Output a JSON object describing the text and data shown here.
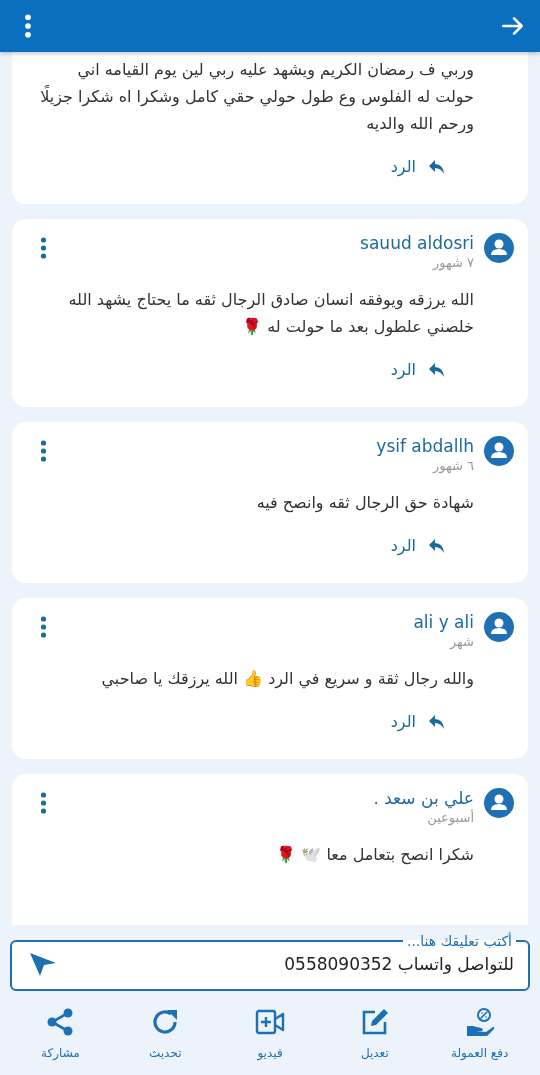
{
  "comments": [
    {
      "text": "وربي ف رمضان الكريم ويشهد عليه ربي لين يوم القيامه اني حولت له الفلوس وع طول حولي حقي كامل وشكرا اه شكرا جزيلًا ورحم الله والديه",
      "reply_label": "الرد"
    },
    {
      "author": "sauud aldosri",
      "time": "٧ شهور",
      "text": "الله يرزقه ويوفقه انسان صادق الرجال ثقه ما يحتاج  يشهد الله خلصني علطول بعد ما حولت له 🌹",
      "reply_label": "الرد"
    },
    {
      "author": "ysif abdallh",
      "time": "٦ شهور",
      "text": "شهادة حق الرجال ثقه وانصح فيه",
      "reply_label": "الرد"
    },
    {
      "author": "ali y ali",
      "time": "شهر",
      "text": "والله رجال ثقة و سريع في الرد 👍 الله يرزقك يا صاحبي",
      "reply_label": "الرد"
    },
    {
      "author": "علي بن سعد .",
      "time": "أسبوعين",
      "text": "شكرا انصح بتعامل معا 🕊️ 🌹"
    }
  ],
  "composer": {
    "label": "أكتب تعليقك هنا...",
    "value": "للتواصل واتساب 0558090352"
  },
  "bottom_nav": [
    {
      "kind": "commission",
      "label": "دفع العمولة"
    },
    {
      "kind": "edit",
      "label": "تعديل"
    },
    {
      "kind": "video",
      "label": "فيديو"
    },
    {
      "kind": "refresh",
      "label": "تحديث"
    },
    {
      "kind": "share",
      "label": "مشاركة"
    }
  ]
}
